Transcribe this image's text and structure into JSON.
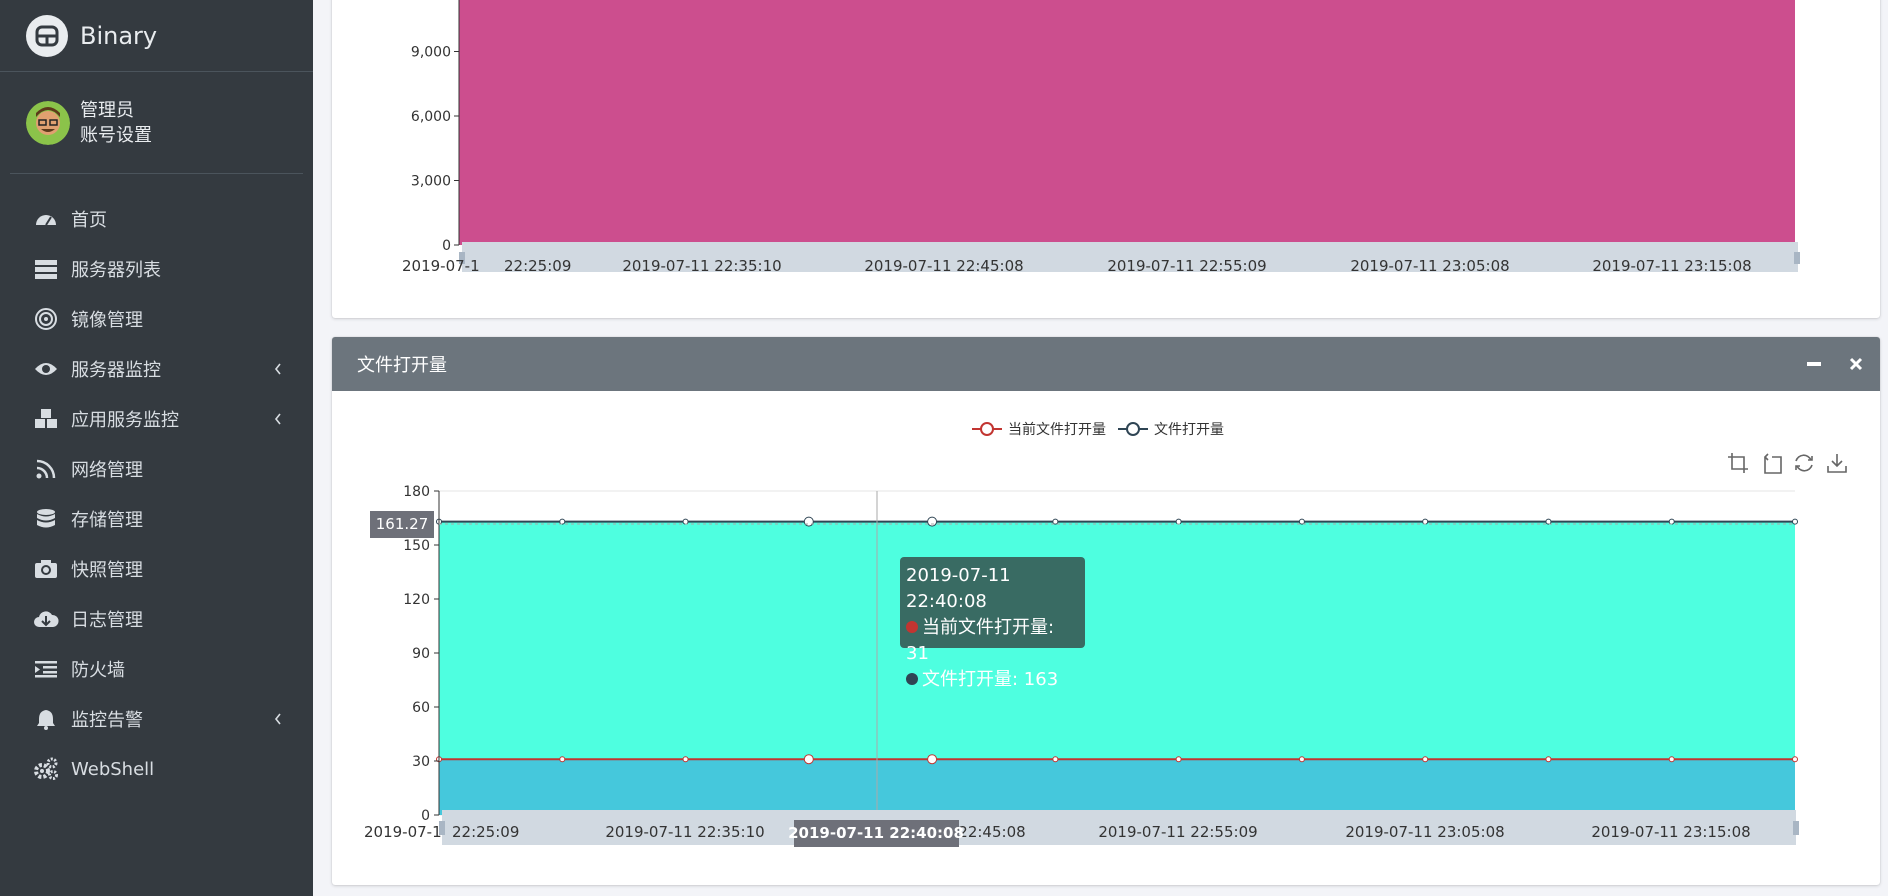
{
  "app": {
    "name": "Binary"
  },
  "user": {
    "name": "管理员",
    "settings": "账号设置"
  },
  "nav": [
    {
      "label": "首页",
      "icon": "dashboard-icon",
      "chevron": false
    },
    {
      "label": "服务器列表",
      "icon": "server-list-icon",
      "chevron": false
    },
    {
      "label": "镜像管理",
      "icon": "image-icon",
      "chevron": false
    },
    {
      "label": "服务器监控",
      "icon": "eye-icon",
      "chevron": true
    },
    {
      "label": "应用服务监控",
      "icon": "cubes-icon",
      "chevron": true
    },
    {
      "label": "网络管理",
      "icon": "rss-icon",
      "chevron": false
    },
    {
      "label": "存储管理",
      "icon": "database-icon",
      "chevron": false
    },
    {
      "label": "快照管理",
      "icon": "camera-icon",
      "chevron": false
    },
    {
      "label": "日志管理",
      "icon": "cloud-download-icon",
      "chevron": false
    },
    {
      "label": "防火墙",
      "icon": "firewall-icon",
      "chevron": false
    },
    {
      "label": "监控告警",
      "icon": "bell-icon",
      "chevron": true
    },
    {
      "label": "WebShell",
      "icon": "cogs-icon",
      "chevron": false
    }
  ],
  "colors": {
    "sidebar": "#343a40",
    "header": "#6c757d",
    "area_top": "#cc4e8e",
    "area_teal": "#4effe0",
    "area_blue": "#45c8dc",
    "red_series": "#c23531",
    "dark_series": "#2f4554"
  },
  "card2": {
    "title": "文件打开量"
  },
  "chart_data": [
    {
      "type": "area",
      "title": "",
      "yticks": [
        "0",
        "3,000",
        "6,000",
        "9,000"
      ],
      "xticks": [
        "2019-07-1",
        "22:25:09",
        "2019-07-11 22:35:10",
        "2019-07-11 22:45:08",
        "2019-07-11 22:55:09",
        "2019-07-11 23:05:08",
        "2019-07-11 23:15:08"
      ],
      "series": [
        {
          "values": [
            12000,
            12000,
            12000,
            12000,
            12000,
            12000,
            12000,
            12000,
            12000,
            12000,
            12000,
            12000
          ]
        }
      ]
    },
    {
      "type": "area",
      "title": "文件打开量",
      "legend": [
        "当前文件打开量",
        "文件打开量"
      ],
      "ylim": [
        0,
        180
      ],
      "yticks": [
        "0",
        "30",
        "60",
        "90",
        "120",
        "150",
        "180"
      ],
      "xticks": [
        "2019-07-1",
        "22:25:09",
        "2019-07-11 22:35:10",
        "2019-07-11 22:45:08",
        "2019-07-11 22:55:09",
        "2019-07-11 23:05:08",
        "2019-07-11 23:15:08"
      ],
      "series": [
        {
          "name": "当前文件打开量",
          "values": [
            31,
            31,
            31,
            31,
            31,
            31,
            31,
            31,
            31,
            31,
            31,
            31
          ]
        },
        {
          "name": "文件打开量",
          "values": [
            163,
            163,
            163,
            163,
            163,
            163,
            163,
            163,
            163,
            163,
            163,
            163
          ]
        }
      ],
      "axis_pointer": {
        "y_label": "161.27",
        "x_label": "2019-07-11 22:40:08"
      },
      "tooltip": {
        "time": "2019-07-11 22:40:08",
        "line1": "当前文件打开量: 31",
        "line2": "文件打开量: 163"
      }
    }
  ]
}
